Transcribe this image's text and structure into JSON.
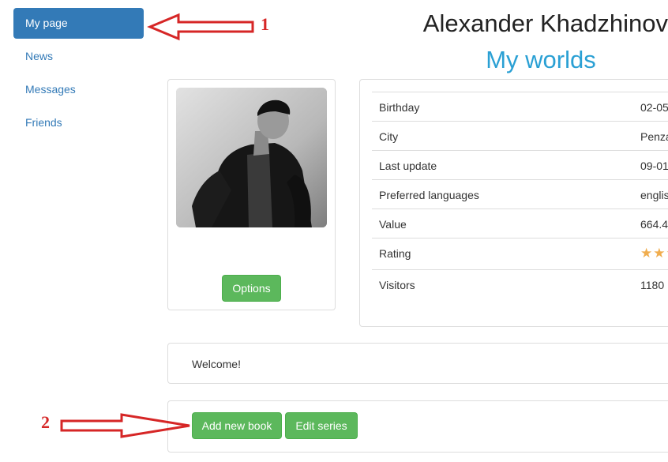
{
  "sidebar": {
    "items": [
      {
        "label": "My page"
      },
      {
        "label": "News"
      },
      {
        "label": "Messages"
      },
      {
        "label": "Friends"
      }
    ]
  },
  "header": {
    "user_name": "Alexander Khadzhinov",
    "subtitle": "My worlds"
  },
  "profile": {
    "options_label": "Options"
  },
  "info": {
    "rows": [
      {
        "key": "Birthday",
        "value": "02-05"
      },
      {
        "key": "City",
        "value": "Penza"
      },
      {
        "key": "Last update",
        "value": "09-01"
      },
      {
        "key": "Preferred languages",
        "value": "englis"
      },
      {
        "key": "Value",
        "value": "664.4"
      },
      {
        "key": "Rating",
        "value": "★★★"
      },
      {
        "key": "Visitors",
        "value": "1180"
      }
    ]
  },
  "welcome": {
    "text": "Welcome!"
  },
  "actions": {
    "add_book_label": "Add new book",
    "edit_series_label": "Edit series"
  },
  "annotations": {
    "label1": "1",
    "label2": "2",
    "color": "#d62626"
  },
  "colors": {
    "primary": "#337ab7",
    "success": "#5cb85c",
    "title_accent": "#2aa0d4",
    "star": "#f0ad4e"
  }
}
